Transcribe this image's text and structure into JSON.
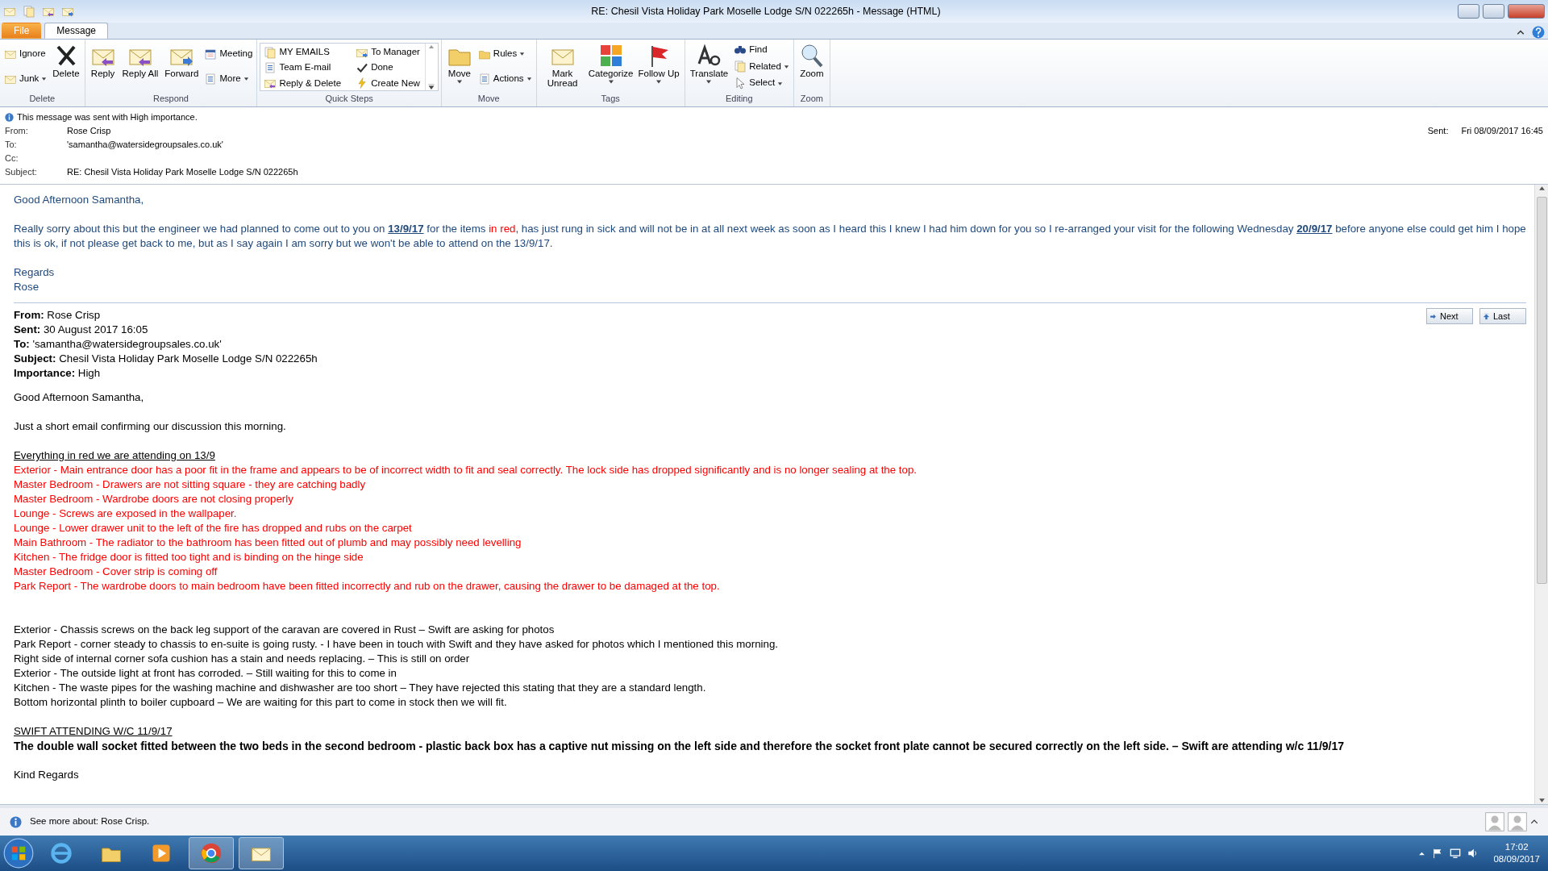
{
  "window": {
    "title": "RE: Chesil Vista Holiday Park  Moselle Lodge  S/N 022265h  -  Message (HTML)"
  },
  "tabs": [
    {
      "label": "File",
      "kind": "file",
      "selected": false
    },
    {
      "label": "Message",
      "kind": "tab",
      "selected": true
    }
  ],
  "ribbon": {
    "groups": [
      {
        "label": "Delete",
        "items": [
          {
            "label": "Ignore",
            "kind": "small",
            "menu": false
          },
          {
            "label": "Junk",
            "kind": "small",
            "menu": true
          },
          {
            "label": "Delete",
            "kind": "large",
            "menu": false
          }
        ]
      },
      {
        "label": "Respond",
        "items": [
          {
            "label": "Reply",
            "kind": "large",
            "menu": false
          },
          {
            "label": "Reply All",
            "kind": "large",
            "menu": false
          },
          {
            "label": "Forward",
            "kind": "large",
            "menu": false
          },
          {
            "label": "Meeting",
            "kind": "small",
            "menu": false
          },
          {
            "label": "More",
            "kind": "small",
            "menu": true
          }
        ]
      },
      {
        "label": "Quick Steps",
        "items": [
          {
            "label": "MY EMAILS",
            "kind": "quick",
            "menu": false
          },
          {
            "label": "Team E-mail",
            "kind": "quick",
            "menu": false
          },
          {
            "label": "Reply & Delete",
            "kind": "quick",
            "menu": false
          },
          {
            "label": "To Manager",
            "kind": "quick",
            "menu": false
          },
          {
            "label": "Done",
            "kind": "quick",
            "menu": false
          },
          {
            "label": "Create New",
            "kind": "quick",
            "menu": false
          }
        ]
      },
      {
        "label": "Move",
        "items": [
          {
            "label": "Move",
            "kind": "large",
            "menu": true
          },
          {
            "label": "Rules",
            "kind": "small",
            "menu": true
          },
          {
            "label": "Actions",
            "kind": "small",
            "menu": true
          }
        ]
      },
      {
        "label": "Tags",
        "items": [
          {
            "label": "Mark Unread",
            "kind": "large",
            "menu": false
          },
          {
            "label": "Categorize",
            "kind": "large",
            "menu": true
          },
          {
            "label": "Follow Up",
            "kind": "large",
            "menu": true
          }
        ]
      },
      {
        "label": "Editing",
        "items": [
          {
            "label": "Translate",
            "kind": "large",
            "menu": true
          },
          {
            "label": "Find",
            "kind": "small",
            "menu": false
          },
          {
            "label": "Related",
            "kind": "small",
            "menu": true
          },
          {
            "label": "Select",
            "kind": "small",
            "menu": true
          }
        ]
      },
      {
        "label": "Zoom",
        "items": [
          {
            "label": "Zoom",
            "kind": "large",
            "menu": false
          }
        ]
      }
    ]
  },
  "header": {
    "notice": "This message was sent with High importance.",
    "fields": [
      {
        "label": "From:",
        "value": "Rose Crisp"
      },
      {
        "label": "To:",
        "value": "'samantha@watersidegroupsales.co.uk'"
      },
      {
        "label": "Cc:"
      },
      {
        "label": "Subject:",
        "value": "RE: Chesil Vista Holiday Park  Moselle Lodge  S/N 022265h"
      }
    ],
    "sent": {
      "label": "Sent:",
      "value": "Fri 08/09/2017 16:45"
    }
  },
  "reply": {
    "greeting": "Good Afternoon Samantha,",
    "paragraph": [
      {
        "kind": "text",
        "text": "Really sorry about this but the engineer we had planned to come out to you on "
      },
      {
        "kind": "link",
        "text": "13/9/17"
      },
      {
        "kind": "text",
        "text": " for the items "
      },
      {
        "kind": "red",
        "text": "in red"
      },
      {
        "kind": "text",
        "text": ",  has just rung in sick and will not be in at all next week  as soon as I heard this I knew I had him down for you so I re-arranged your visit  for the following Wednesday "
      },
      {
        "kind": "link",
        "text": "20/9/17"
      },
      {
        "kind": "text",
        "text": " before anyone else could get him I hope this is ok, if not please get back to me, but as I say again I am sorry but we won't be able to attend on the 13/9/17."
      }
    ],
    "signoff": [
      "Regards",
      "Rose"
    ]
  },
  "quoted": {
    "headers": [
      "**From:** Rose Crisp",
      "**Sent:** 30 August 2017 16:05",
      "**To:** 'samantha@watersidegroupsales.co.uk'",
      "**Subject:** Chesil Vista Holiday Park Moselle Lodge S/N 022265h",
      "**Importance:** High"
    ],
    "nav": [
      {
        "label": "Next",
        "kind": "next"
      },
      {
        "label": "Last",
        "kind": "last"
      }
    ],
    "blocks": [
      {
        "kind": "para",
        "lines": [
          "Good Afternoon Samantha,"
        ]
      },
      {
        "kind": "para",
        "lines": [
          "Just a short email confirming our discussion this morning."
        ]
      },
      {
        "kind": "heading",
        "lines": [
          "Everything in red we are attending on 13/9"
        ]
      },
      {
        "kind": "red",
        "lines": [
          "Exterior - Main entrance door has a poor fit in the frame and appears to be of incorrect width to fit and seal correctly. The lock side has dropped significantly and is no longer sealing at the top.",
          "Master Bedroom - Drawers are not sitting square - they are catching badly",
          "Master Bedroom - Wardrobe doors are not closing properly",
          "Lounge - Screws are exposed in the wallpaper.",
          "Lounge - Lower drawer unit to the left of the fire has dropped and rubs on the carpet",
          "Main Bathroom - The radiator to the bathroom has been fitted out of plumb and may possibly need levelling",
          "Kitchen - The fridge door is fitted too tight and is binding on the hinge side",
          "Master Bedroom - Cover strip is coming off",
          "Park Report - The wardrobe doors to main bedroom have been fitted incorrectly and rub on the drawer, causing the drawer to be damaged at the top."
        ]
      },
      {
        "kind": "spaced",
        "lines": [
          "Exterior - Chassis screws on the back leg support of the caravan are covered in Rust – Swift are asking for photos",
          "Park Report - corner steady to chassis to en-suite is going rusty. - I have been in touch with Swift  and they have asked for photos  which I mentioned this morning.",
          "Right side of internal corner sofa cushion has a stain and needs replacing. – This is still on order",
          "Exterior - The outside light at front has corroded. – Still waiting for this to come in",
          "Kitchen - The waste pipes for the washing machine and dishwasher are too short – They have rejected this stating that they are a standard length.",
          "Bottom horizontal plinth to boiler cupboard – We are waiting for this part to come in stock then we will fit."
        ]
      },
      {
        "kind": "heading",
        "lines": [
          "SWIFT ATTENDING W/C 11/9/17"
        ]
      },
      {
        "kind": "bold",
        "lines": [
          "The double wall socket fitted between the two beds in the second bedroom - plastic back box has a captive nut missing on the left side and therefore the socket front plate cannot be secured correctly on the left side. – Swift are attending w/c 11/9/17"
        ]
      },
      {
        "kind": "para",
        "lines": [
          "Kind Regards"
        ]
      }
    ]
  },
  "people_pane": {
    "text": "See more about: Rose Crisp."
  },
  "taskbar": {
    "apps": [
      {
        "running": false
      },
      {
        "running": false
      },
      {
        "running": false
      },
      {
        "running": true
      },
      {
        "running": true
      }
    ],
    "time": "17:02",
    "date": "08/09/2017"
  }
}
